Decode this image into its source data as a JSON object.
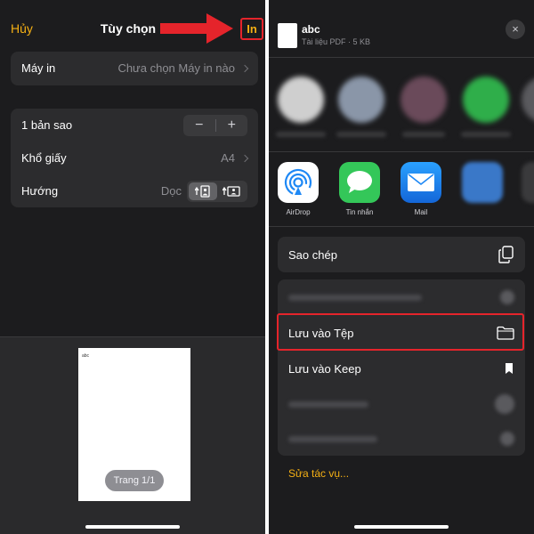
{
  "print_options": {
    "cancel_label": "Hủy",
    "title": "Tùy chọn",
    "print_label": "In",
    "printer": {
      "label": "Máy in",
      "value": "Chưa chọn Máy in nào"
    },
    "copies": {
      "label": "1 bản sao",
      "minus": "−",
      "plus": "+"
    },
    "paper_size": {
      "label": "Khổ giấy",
      "value": "A4"
    },
    "orientation": {
      "label": "Hướng",
      "value": "Dọc",
      "selected": "portrait"
    },
    "preview": {
      "page_text": "abc",
      "page_badge": "Trang 1/1"
    }
  },
  "share_sheet": {
    "file_name": "abc",
    "file_meta": "Tài liệu PDF · 5 KB",
    "close_icon": "×",
    "apps": [
      {
        "label": "AirDrop",
        "icon": "airdrop-icon",
        "color": "#ffffff"
      },
      {
        "label": "Tin nhắn",
        "icon": "messages-icon",
        "color": "#34c759"
      },
      {
        "label": "Mail",
        "icon": "mail-icon",
        "color": "#1e88f5"
      }
    ],
    "actions": {
      "copy_label": "Sao chép",
      "save_files_label": "Lưu vào Tệp",
      "save_keep_label": "Lưu vào Keep",
      "edit_actions_label": "Sửa tác vụ..."
    }
  },
  "colors": {
    "accent": "#f5b014",
    "highlight": "#e5242b",
    "background": "#1c1c1e",
    "card": "#2c2c2e"
  }
}
